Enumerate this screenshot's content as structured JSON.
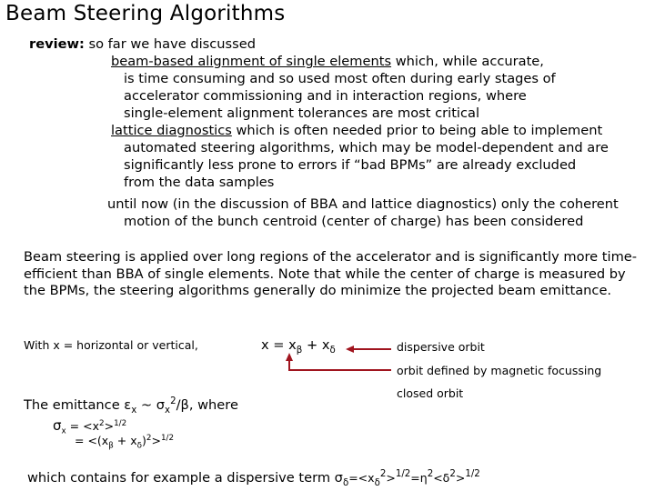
{
  "title": "Beam Steering Algorithms",
  "review": {
    "label": "review:",
    "intro": "so far we have discussed",
    "item1_link": "beam-based alignment of single elements",
    "item1_rest": " which, while accurate,",
    "item1_lines": [
      "is time consuming and so used most often during early stages of",
      "accelerator commissioning and in interaction regions, where",
      "single-element alignment tolerances are most critical"
    ],
    "item2_link": "lattice diagnostics",
    "item2_rest": " which is often needed prior to being able to implement",
    "item2_lines": [
      "automated steering algorithms, which may be model-dependent and are",
      "significantly less prone to errors if “bad BPMs” are already excluded",
      "from the data samples"
    ],
    "item3_first": "until now (in the discussion of BBA and lattice diagnostics) only the coherent",
    "item3_second": "motion of the bunch centroid (center of charge) has been considered"
  },
  "paragraph": "Beam steering is applied over long regions of the accelerator and is significantly more time-efficient than BBA of single elements.  Note that while the center of charge is measured by the BPMs, the steering algorithms generally do minimize the projected beam emittance.",
  "equation_section": {
    "with_text": "With x = horizontal or vertical,",
    "eq_x": "x = x",
    "eq_beta_sub": "β",
    "eq_plus": " + x",
    "eq_delta_sub": "δ",
    "label_dispersive": "dispersive orbit",
    "label_magnetic": "orbit defined by magnetic focussing",
    "label_closed": "closed orbit",
    "arrow_color": "#a0141e"
  },
  "emittance": {
    "intro_a": "The emittance ε",
    "intro_sub": "x",
    "intro_b": " ~ σ",
    "intro_sub2": "x",
    "intro_sup": "2",
    "intro_c": "/β, where",
    "sigma_line1_a": "σ",
    "sigma_line1_sub": "x",
    "sigma_line1_b": " = <x",
    "sigma_line1_sup": "2",
    "sigma_line1_c": ">",
    "sigma_line1_sup2": "1/2",
    "sigma_line2_a": "= <(x",
    "sigma_line2_sub1": "β",
    "sigma_line2_b": " + x",
    "sigma_line2_sub2": "δ",
    "sigma_line2_c": ")",
    "sigma_line2_sup": "2",
    "sigma_line2_d": ">",
    "sigma_line2_sup2": "1/2"
  },
  "footer": {
    "text": "which contains for example a dispersive term σ",
    "sub1": "δ",
    "p2": "=<x",
    "sub2": "δ",
    "sup1": "2",
    "p3": ">",
    "sup2": "1/2",
    "p4": "=η",
    "sup3": "2",
    "p5": "<δ",
    "sup4": "2",
    "p6": ">",
    "sup5": "1/2"
  }
}
